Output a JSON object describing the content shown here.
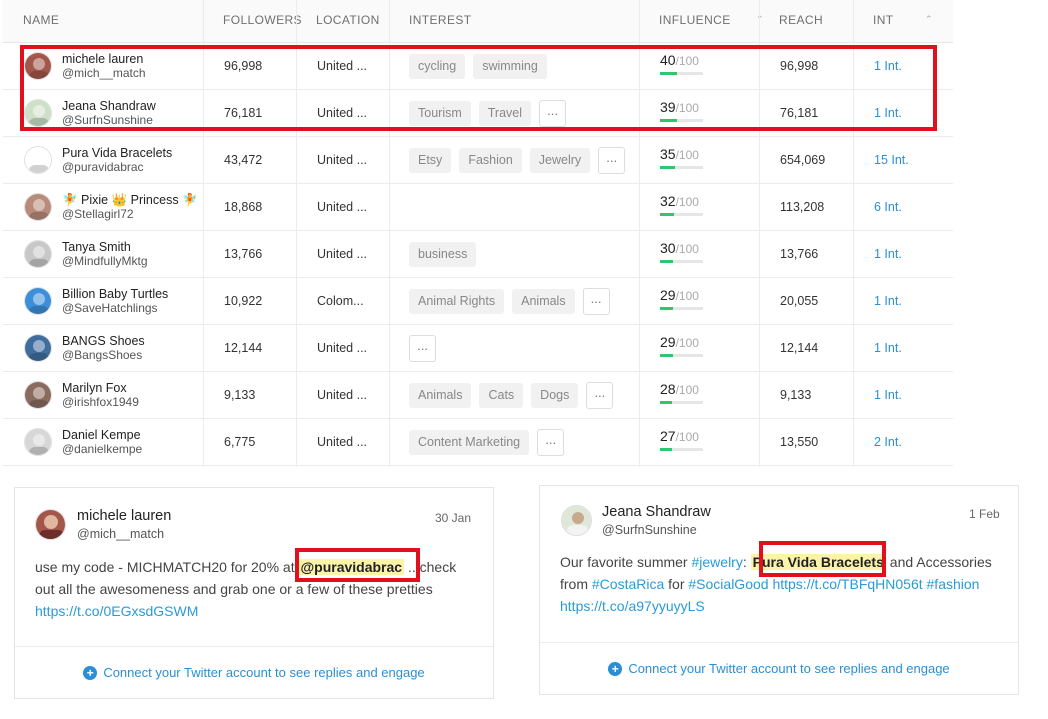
{
  "columns": {
    "name": "NAME",
    "followers": "FOLLOWERS",
    "location": "LOCATION",
    "interest": "INTEREST",
    "influence": "INFLUENCE",
    "reach": "REACH",
    "int": "INT"
  },
  "rows": [
    {
      "name": "michele lauren",
      "handle": "@mich__match",
      "followers": "96,998",
      "location": "United ...",
      "tags": [
        "cycling",
        "swimming"
      ],
      "more": false,
      "score": "40",
      "outof": "/100",
      "score_value": 40,
      "reach": "96,998",
      "int": "1 Int."
    },
    {
      "name": "Jeana Shandraw",
      "handle": "@SurfnSunshine",
      "followers": "76,181",
      "location": "United ...",
      "tags": [
        "Tourism",
        "Travel"
      ],
      "more": true,
      "score": "39",
      "outof": "/100",
      "score_value": 39,
      "reach": "76,181",
      "int": "1 Int."
    },
    {
      "name": "Pura Vida Bracelets",
      "handle": "@puravidabrac",
      "followers": "43,472",
      "location": "United ...",
      "tags": [
        "Etsy",
        "Fashion",
        "Jewelry"
      ],
      "more": true,
      "score": "35",
      "outof": "/100",
      "score_value": 35,
      "reach": "654,069",
      "int": "15 Int."
    },
    {
      "name": "🧚 Pixie 👑 Princess 🧚",
      "handle": "@Stellagirl72",
      "followers": "18,868",
      "location": "United ...",
      "tags": [],
      "more": false,
      "score": "32",
      "outof": "/100",
      "score_value": 32,
      "reach": "113,208",
      "int": "6 Int."
    },
    {
      "name": "Tanya Smith",
      "handle": "@MindfullyMktg",
      "followers": "13,766",
      "location": "United ...",
      "tags": [
        "business"
      ],
      "more": false,
      "score": "30",
      "outof": "/100",
      "score_value": 30,
      "reach": "13,766",
      "int": "1 Int."
    },
    {
      "name": "Billion Baby Turtles",
      "handle": "@SaveHatchlings",
      "followers": "10,922",
      "location": "Colom...",
      "tags": [
        "Animal Rights",
        "Animals"
      ],
      "more": true,
      "score": "29",
      "outof": "/100",
      "score_value": 29,
      "reach": "20,055",
      "int": "1 Int."
    },
    {
      "name": "BANGS Shoes",
      "handle": "@BangsShoes",
      "followers": "12,144",
      "location": "United ...",
      "tags": [],
      "more": true,
      "score": "29",
      "outof": "/100",
      "score_value": 29,
      "reach": "12,144",
      "int": "1 Int."
    },
    {
      "name": "Marilyn Fox",
      "handle": "@irishfox1949",
      "followers": "9,133",
      "location": "United ...",
      "tags": [
        "Animals",
        "Cats",
        "Dogs"
      ],
      "more": true,
      "score": "28",
      "outof": "/100",
      "score_value": 28,
      "reach": "9,133",
      "int": "1 Int."
    },
    {
      "name": "Daniel Kempe",
      "handle": "@danielkempe",
      "followers": "6,775",
      "location": "United ...",
      "tags": [
        "Content Marketing"
      ],
      "more": true,
      "score": "27",
      "outof": "/100",
      "score_value": 27,
      "reach": "13,550",
      "int": "2 Int."
    }
  ],
  "more_glyph": "...",
  "sort_glyph": "⌃",
  "tweets": [
    {
      "name": "michele lauren",
      "handle": "@mich__match",
      "date": "30 Jan",
      "text_1": "use my code - MICHMATCH20 for 20% at ",
      "mention": "@puravidabrac",
      "text_2": " ...check out all the awesomeness and grab one or a few of these pretties ",
      "link": "https://t.co/0EGxsdGSWM",
      "connect": "Connect your Twitter account to see replies and engage"
    },
    {
      "name": "Jeana Shandraw",
      "handle": "@SurfnSunshine",
      "date": "1 Feb",
      "text_1": "Our favorite summer ",
      "tag_jewelry": "#jewelry",
      "text_2": ": ",
      "highlight": "Pura Vida Bracelets",
      "text_3": " and Accessories from ",
      "tag_costarica": "#CostaRica",
      "text_4": " for ",
      "tag_socialgood": "#SocialGood",
      "link_1": "https://t.co/TBFqHN056t",
      "tag_fashion": "#fashion",
      "link_2": "https://t.co/a97yyuyyLS",
      "connect": "Connect your Twitter account to see replies and engage"
    }
  ],
  "colors": {
    "accent": "#2a8fd6",
    "highlight_box": "#e2101c",
    "score_bar": "#2ec76b",
    "mark_bg": "#fbf4a8"
  }
}
